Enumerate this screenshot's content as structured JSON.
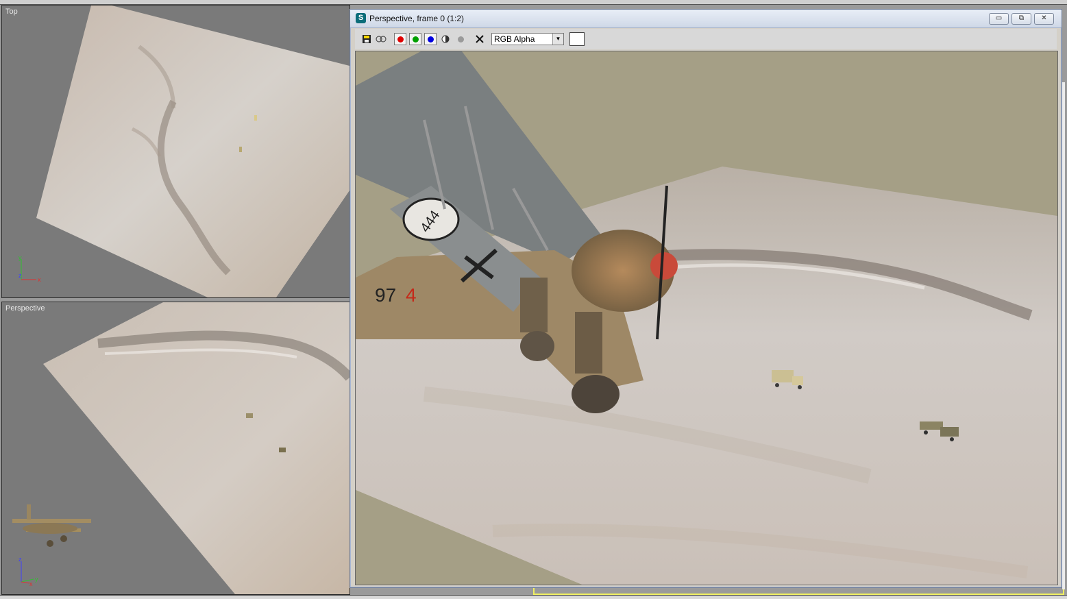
{
  "viewports": {
    "top": {
      "label": "Top"
    },
    "perspective": {
      "label": "Perspective"
    }
  },
  "axes_top": {
    "x": "x",
    "y": "y",
    "z": "z"
  },
  "axes_persp": {
    "x": "x",
    "y": "y",
    "z": "z"
  },
  "render_window": {
    "title": "Perspective, frame 0 (1:2)",
    "controls": {
      "minimize": "▭",
      "restore": "⧉",
      "close": "✕"
    },
    "toolbar": {
      "channel_select": "RGB Alpha"
    }
  },
  "aircraft": {
    "fuselage_code": "97",
    "fuselage_number": "4",
    "wing_roundel": "444",
    "rudder_mark": "X"
  },
  "colors": {
    "viewport_bg": "#7a7a7a",
    "sky": "#a59f86",
    "terrain": "#c9c0b6",
    "red_channel": "#e00000",
    "green_channel": "#00a000",
    "blue_channel": "#0000e0",
    "selection_highlight": "#ffff60"
  }
}
